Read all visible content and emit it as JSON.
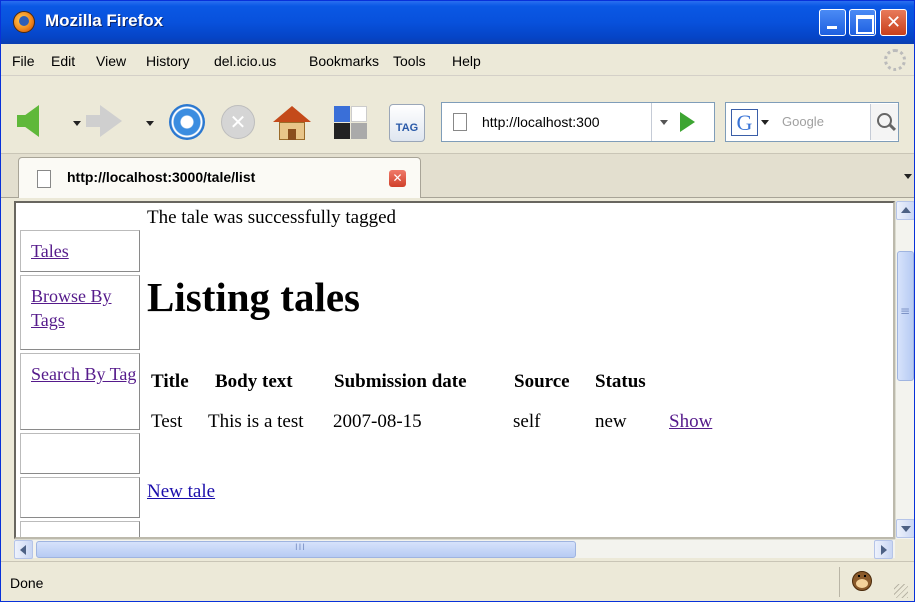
{
  "window": {
    "title": "Mozilla Firefox"
  },
  "menu": {
    "items": [
      "File",
      "Edit",
      "View",
      "History",
      "del.icio.us",
      "Bookmarks",
      "Tools",
      "Help"
    ]
  },
  "toolbar": {
    "tag_label": "TAG",
    "url": "http://localhost:300",
    "search_engine_letter": "G",
    "search_placeholder": "Google"
  },
  "tabs": [
    {
      "title": "http://localhost:3000/tale/list",
      "close_label": "x"
    }
  ],
  "sidebar": {
    "links": [
      "Tales",
      "Browse By Tags",
      "Search By Tag"
    ]
  },
  "page": {
    "notice": "The tale was successfully tagged",
    "heading": "Listing tales",
    "table": {
      "headers": [
        "Title",
        "Body text",
        "Submission date",
        "Source",
        "Status"
      ],
      "rows": [
        [
          "Test",
          "This is a test",
          "2007-08-15",
          "self",
          "new",
          "Show"
        ]
      ]
    },
    "new_link": "New tale"
  },
  "status": {
    "text": "Done"
  },
  "colors": {
    "titlebar": "#0851dc",
    "visited_link": "#551a8b",
    "link": "#1a0dab",
    "chrome": "#ece9d8"
  }
}
